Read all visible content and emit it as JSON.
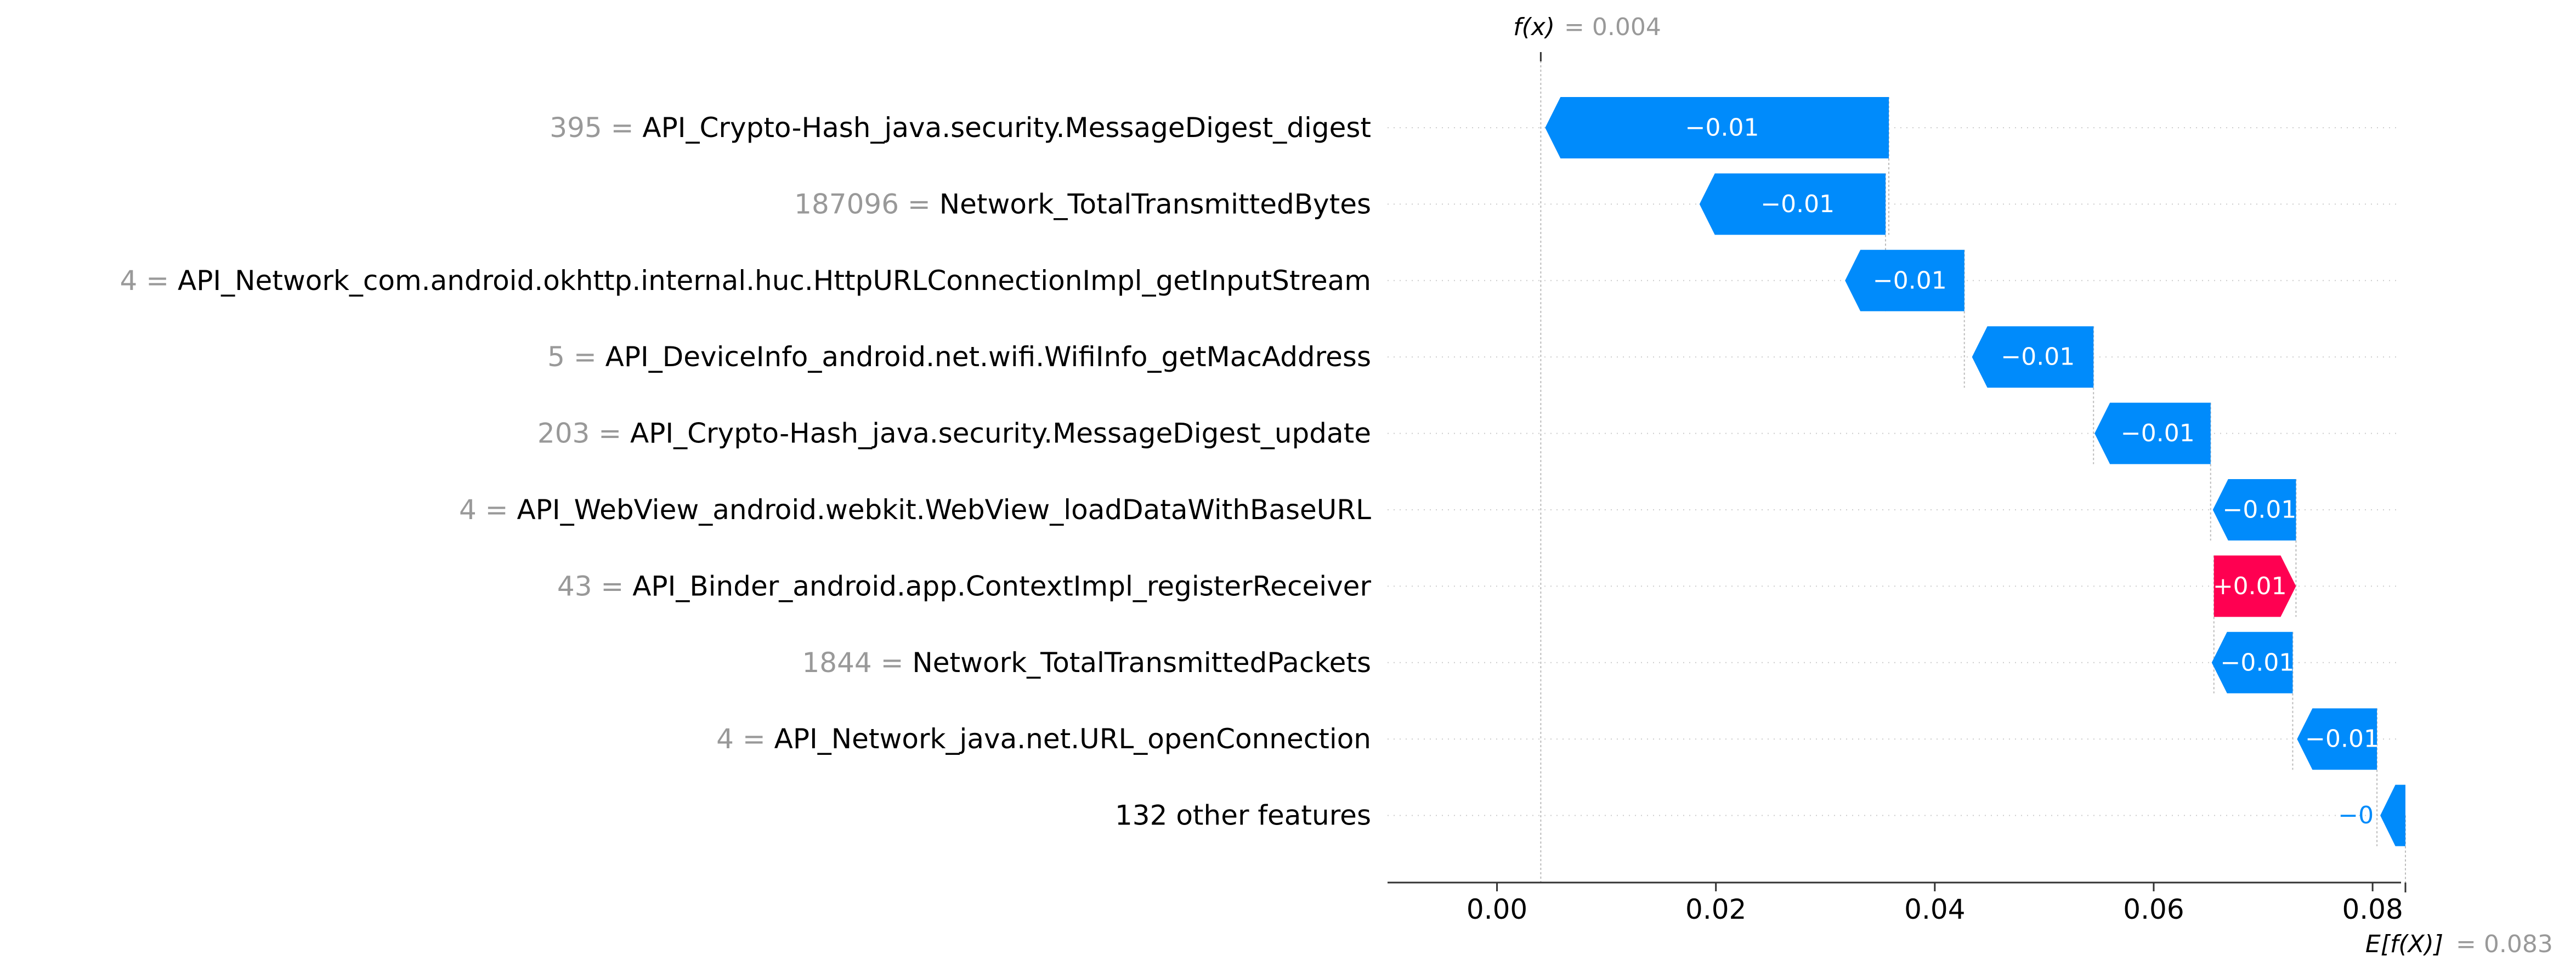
{
  "chart_data": {
    "type": "waterfall",
    "fx_label": "f(x)",
    "fx_value": "= 0.004",
    "ex_label": "E[f(X)]",
    "ex_value": "= 0.083",
    "fx": 0.004,
    "base_value": 0.083,
    "xlim": [
      -0.01,
      0.0826
    ],
    "xticks": [
      0.0,
      0.02,
      0.04,
      0.06,
      0.08
    ],
    "xtick_labels": [
      "0.00",
      "0.02",
      "0.04",
      "0.06",
      "0.08"
    ],
    "colors": {
      "negative": "#008bfb",
      "positive": "#ff0051",
      "value_gray": "#999999",
      "label": "#000000"
    },
    "features": [
      {
        "value": "395",
        "name": "API_Crypto-Hash_java.security.MessageDigest_digest",
        "start": 0.0358,
        "end": 0.0044,
        "label": "−0.01"
      },
      {
        "value": "187096",
        "name": "Network_TotalTransmittedBytes",
        "start": 0.0355,
        "end": 0.0185,
        "label": "−0.01"
      },
      {
        "value": "4",
        "name": "API_Network_com.android.okhttp.internal.huc.HttpURLConnectionImpl_getInputStream",
        "start": 0.0427,
        "end": 0.0318,
        "label": "−0.01"
      },
      {
        "value": "5",
        "name": "API_DeviceInfo_android.net.wifi.WifiInfo_getMacAddress",
        "start": 0.0545,
        "end": 0.0434,
        "label": "−0.01"
      },
      {
        "value": "203",
        "name": "API_Crypto-Hash_java.security.MessageDigest_update",
        "start": 0.0652,
        "end": 0.0546,
        "label": "−0.01"
      },
      {
        "value": "4",
        "name": "API_WebView_android.webkit.WebView_loadDataWithBaseURL",
        "start": 0.073,
        "end": 0.0654,
        "label": "−0.01"
      },
      {
        "value": "43",
        "name": "API_Binder_android.app.ContextImpl_registerReceiver",
        "start": 0.0655,
        "end": 0.073,
        "label": "+0.01"
      },
      {
        "value": "1844",
        "name": "Network_TotalTransmittedPackets",
        "start": 0.0727,
        "end": 0.0653,
        "label": "−0.01"
      },
      {
        "value": "4",
        "name": "API_Network_java.net.URL_openConnection",
        "start": 0.0804,
        "end": 0.0731,
        "label": "−0.01"
      },
      {
        "value": "",
        "name": "132 other features",
        "start": 0.083,
        "end": 0.0807,
        "label": "−0"
      }
    ]
  }
}
